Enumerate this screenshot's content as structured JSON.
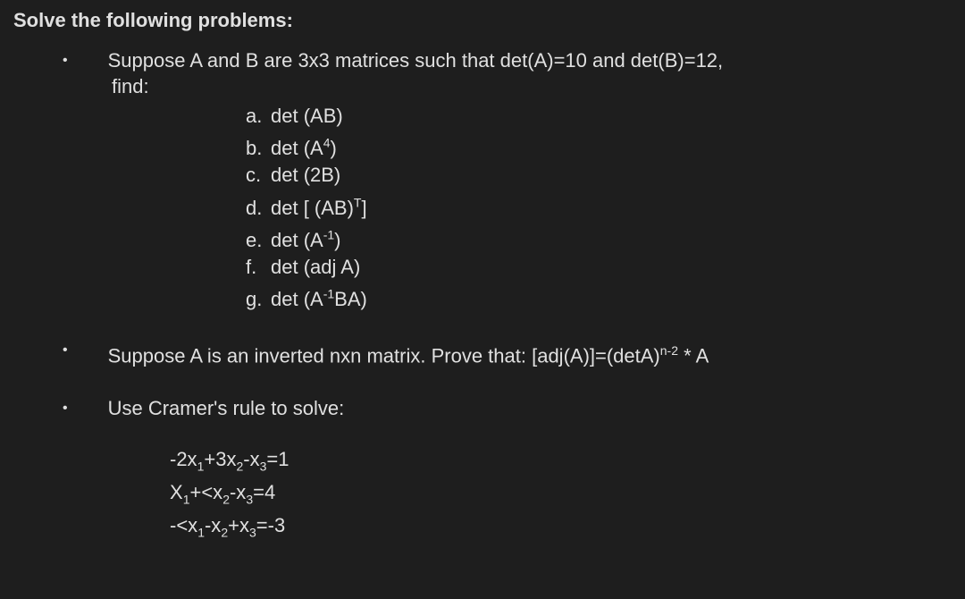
{
  "heading": "Solve the following problems:",
  "problem1": {
    "intro": "Suppose A and B are 3x3 matrices such that det(A)=10 and det(B)=12,",
    "find": "find:",
    "items": [
      {
        "marker": "a.",
        "text": "det (AB)"
      },
      {
        "marker": "b.",
        "text_html": "det (A<sup>4</sup>)"
      },
      {
        "marker": "c.",
        "text": "det (2B)"
      },
      {
        "marker": "d.",
        "text_html": "det [ (AB)<sup>T</sup>]"
      },
      {
        "marker": "e.",
        "text_html": "det (A<sup>-1</sup>)"
      },
      {
        "marker": "f.",
        "text": "det (adj A)"
      },
      {
        "marker": "g.",
        "text_html": "det (A<sup>-1</sup>BA)"
      }
    ]
  },
  "problem2": {
    "text_html": "Suppose A is an inverted nxn matrix. Prove that: [adj(A)]=(detA)<sup>n-2</sup> * A"
  },
  "problem3": {
    "intro": "Use Cramer's rule to solve:",
    "equations": [
      "-2x<sub>1</sub>+3x<sub>2</sub>-x<sub>3</sub>=1",
      "X<sub>1</sub>+&lt;x<sub>2</sub>-x<sub>3</sub>=4",
      "-&lt;x<sub>1</sub>-x<sub>2</sub>+x<sub>3</sub>=-3"
    ]
  },
  "bullet_char": "•"
}
